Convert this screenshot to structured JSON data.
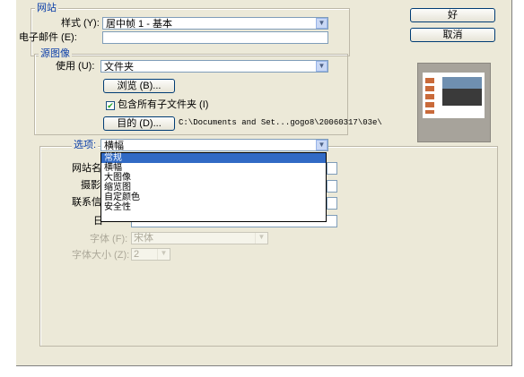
{
  "site_group": {
    "legend": "网站",
    "style_label": "样式 (Y):",
    "style_value": "居中帧 1 - 基本",
    "email_label": "电子邮件 (E):",
    "email_value": ""
  },
  "source_group": {
    "legend": "源图像",
    "use_label": "使用 (U):",
    "use_value": "文件夹",
    "browse_label": "浏览 (B)...",
    "include_subfolders_label": "包含所有子文件夹 (I)",
    "include_subfolders_checked": true,
    "dest_label": "目的 (D)...",
    "dest_path": "C:\\Documents and Set...gogo8\\20060317\\03e\\"
  },
  "options_group": {
    "options_label": "选项:",
    "options_value": "横幅",
    "dropdown_items": [
      "常规",
      "横幅",
      "大图像",
      "缩览图",
      "自定颜色",
      "安全性"
    ],
    "dropdown_selected_index": 0,
    "site_name_label": "网站名",
    "photographer_label": "摄影",
    "contact_label": "联系信",
    "date_label": "日",
    "font_label": "字体 (F):",
    "font_value": "宋体",
    "font_size_label": "字体大小 (Z):",
    "font_size_value": "2"
  },
  "buttons": {
    "ok_label": "好",
    "cancel_label": "取消"
  },
  "colors": {
    "dialog_bg": "#ece9d8",
    "selection": "#316ac5",
    "legend_text": "#0b3ea8"
  }
}
